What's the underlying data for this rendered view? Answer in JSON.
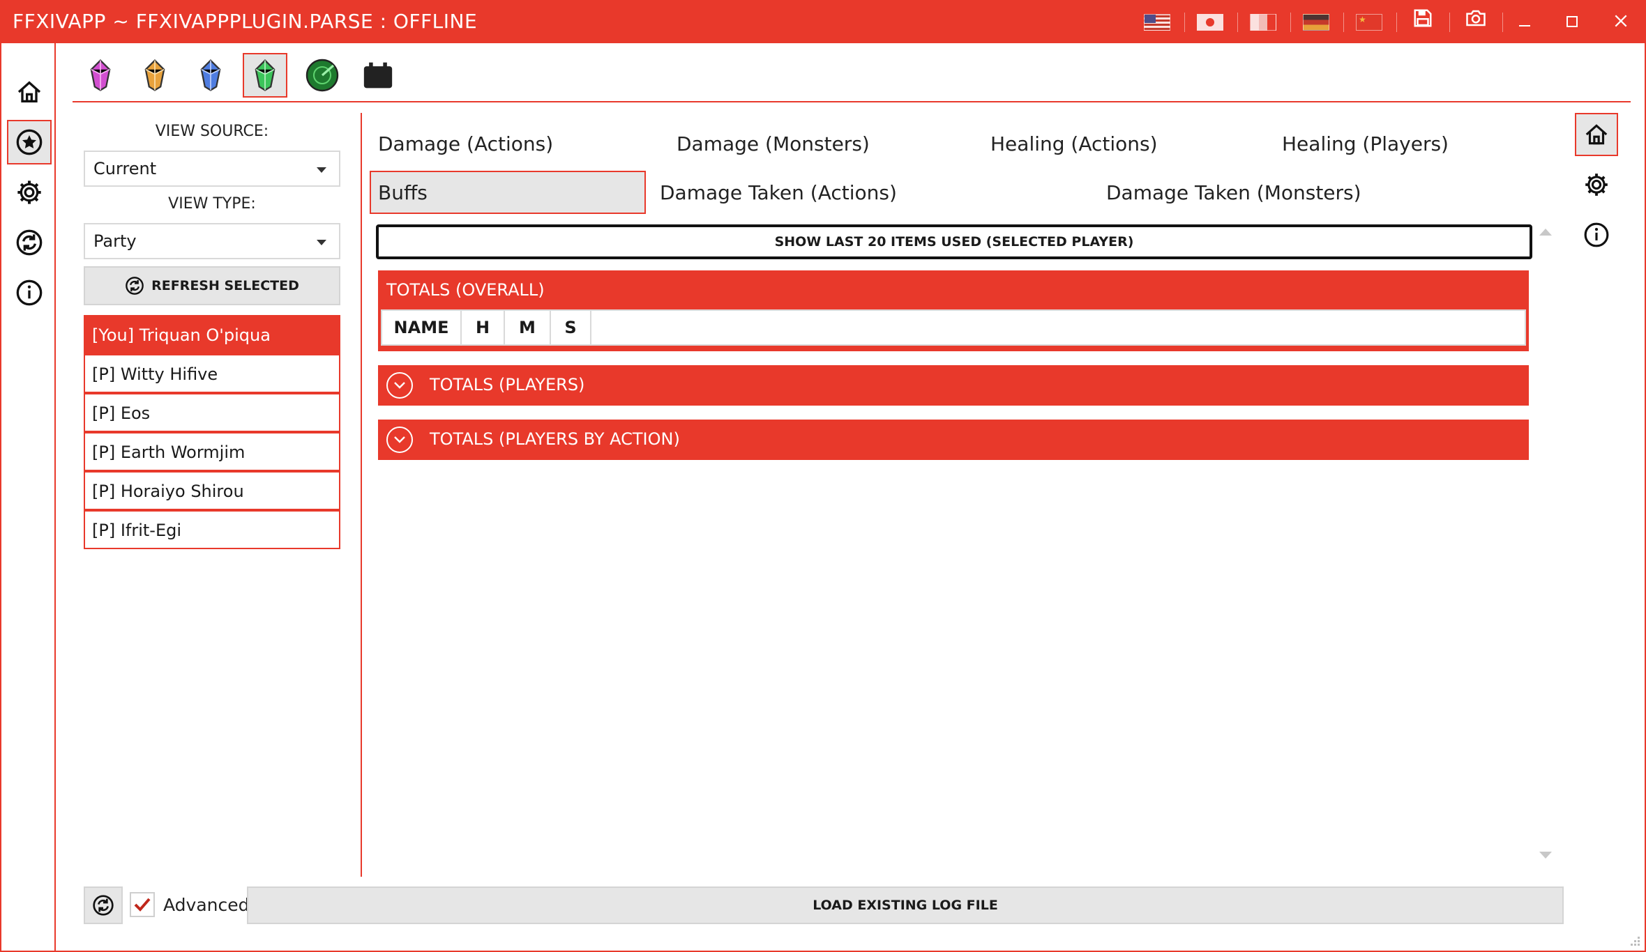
{
  "window": {
    "title": "FFXIVAPP ~ FFXIVAPPPLUGIN.PARSE : OFFLINE",
    "accent_color": "#e8392b",
    "title_icons": [
      "flag-uk-icon",
      "flag-japan-icon",
      "flag-france-icon",
      "flag-germany-icon",
      "flag-china-icon",
      "save-icon",
      "camera-icon"
    ],
    "controls": [
      "minimize-icon",
      "maximize-icon",
      "close-icon"
    ]
  },
  "left_nav": [
    "home-icon",
    "star-icon",
    "gear-icon",
    "update-icon",
    "info-icon"
  ],
  "plugin_tabs": [
    {
      "icon": "pink-crystal-icon",
      "color": "#d24fd0"
    },
    {
      "icon": "orange-crystal-icon",
      "color": "#e8a23c"
    },
    {
      "icon": "blue-crystal-icon",
      "color": "#4f7de0"
    },
    {
      "icon": "green-crystal-icon",
      "color": "#3cc45a"
    },
    {
      "icon": "radar-icon",
      "color": "#1e7a2e"
    },
    {
      "icon": "calendar-icon",
      "color": "#222222"
    }
  ],
  "sidebar": {
    "view_source_label": "VIEW SOURCE:",
    "view_source_value": "Current",
    "view_type_label": "VIEW TYPE:",
    "view_type_value": "Party",
    "refresh_label": "REFRESH SELECTED",
    "players": [
      "[You] Triquan O'piqua",
      "[P] Witty Hifive",
      "[P] Eos",
      "[P] Earth Wormjim",
      "[P] Horaiyo Shirou",
      "[P] Ifrit-Egi"
    ]
  },
  "main": {
    "tabs": [
      "Damage (Actions)",
      "Damage (Monsters)",
      "Healing (Actions)",
      "Healing (Players)",
      "Buffs",
      "Damage Taken (Actions)",
      "Damage Taken (Monsters)"
    ],
    "active_tab": "Buffs",
    "show_last_button": "SHOW LAST 20 ITEMS USED (SELECTED PLAYER)",
    "overall_header": "TOTALS (OVERALL)",
    "grid_columns": [
      "NAME",
      "H",
      "M",
      "S"
    ],
    "players_section": "TOTALS (PLAYERS)",
    "players_by_action_section": "TOTALS (PLAYERS BY ACTION)"
  },
  "right_nav": [
    "home-icon",
    "gear-icon",
    "info-icon"
  ],
  "bottom": {
    "advanced_label": "Advanced",
    "advanced_checked": true,
    "load_log_label": "LOAD EXISTING LOG FILE"
  }
}
